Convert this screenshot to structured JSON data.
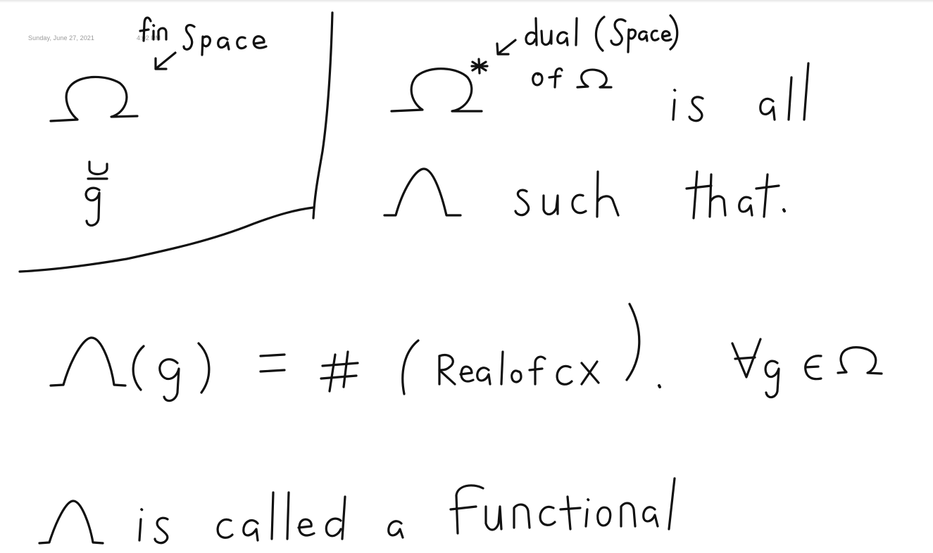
{
  "page": {
    "date": "Sunday, June 27, 2021",
    "time": "4:02 PM"
  },
  "notes": {
    "space_label": "fin Space",
    "omega": "Ω",
    "g_symbol": "g",
    "dual_label": "dual (Space)",
    "of_omega": "of Ω",
    "omega_star": "Ω*",
    "is_all": "is all",
    "lambda": "Λ",
    "such_that": "such that.",
    "equation": "Λ(g) = # (Real of cx). ∀g ∈ Ω",
    "conclusion": "Λ is called a functional"
  }
}
